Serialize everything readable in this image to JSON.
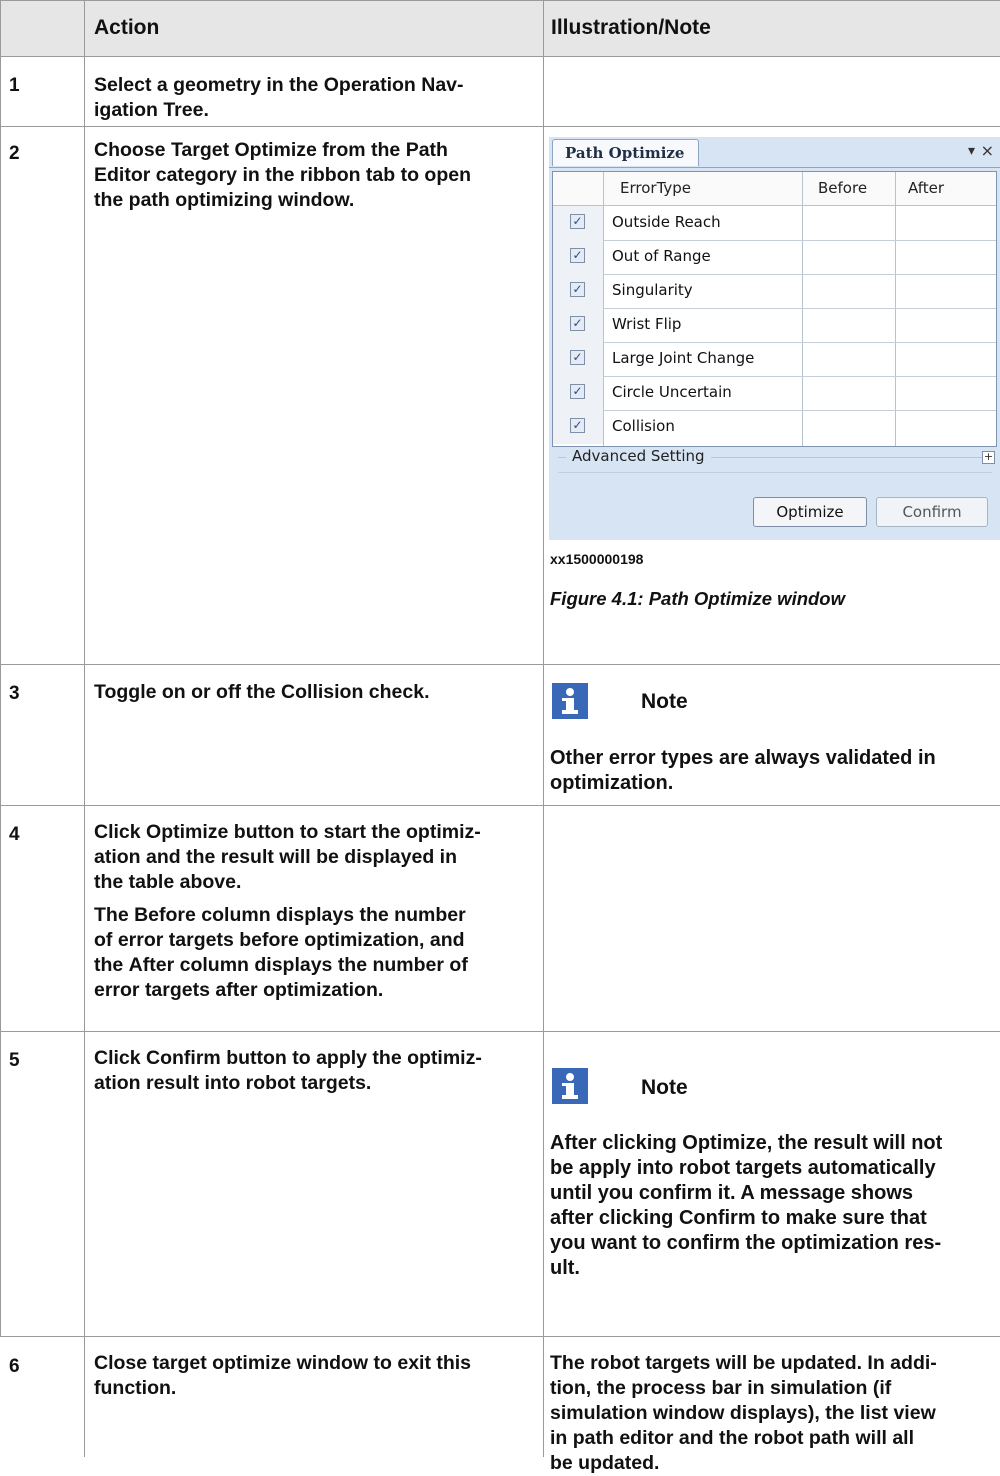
{
  "table": {
    "headers": {
      "step": "",
      "action": "Action",
      "note": "Illustration/Note"
    },
    "rows": [
      {
        "num": "1",
        "action": [
          "Select a geometry in the ",
          "Operation Nav-",
          "igation Tree",
          "."
        ]
      },
      {
        "num": "2",
        "action_line1_pre": "Choose ",
        "action_line1_kw": "Target Optimize",
        "action_line1_post": " from the Path",
        "action_line2": "Editor category in the ribbon tab to open",
        "action_line3": "the path optimizing window."
      },
      {
        "num": "3",
        "action_pre": "Toggle on or off the ",
        "action_kw": "Collision",
        "action_post": " check."
      },
      {
        "num": "4"
      },
      {
        "num": "5"
      },
      {
        "num": "6",
        "action_line1": "Close target optimize window to exit this",
        "action_line2": "function."
      }
    ]
  },
  "widget": {
    "tab_title": "Path Optimize",
    "pin_icon": "▾",
    "close_icon": "×",
    "columns": [
      "ErrorType",
      "Before",
      "After"
    ],
    "error_types": [
      {
        "label": "Outside Reach",
        "checked": true
      },
      {
        "label": "Out of Range",
        "checked": true
      },
      {
        "label": "Singularity",
        "checked": true
      },
      {
        "label": "Wrist Flip",
        "checked": true
      },
      {
        "label": "Large Joint Change",
        "checked": true
      },
      {
        "label": "Circle Uncertain",
        "checked": true
      },
      {
        "label": "Collision",
        "checked": true
      }
    ],
    "advanced_setting": "Advanced Setting",
    "optimize_button": "Optimize",
    "confirm_button": "Confirm"
  },
  "figure": {
    "image_id": "xx1500000198",
    "caption": "Figure 4.1: Path Optimize window"
  },
  "notes": {
    "label": "Note",
    "step3_l1": "Other error types are always validated in",
    "step3_l2": "optimization.",
    "step5_l1_pre": "After clicking ",
    "step5_l1_kw": "Optimize",
    "step5_l1_post": ", the result will not",
    "step5_l2": "be apply into robot targets automatically",
    "step5_l3": "until you confirm it. A message shows",
    "step5_l4_pre": "after clicking ",
    "step5_l4_kw": "Confirm",
    "step5_l4_post": " to make sure that",
    "step5_l5": "you want to confirm the optimization res-",
    "step5_l6": "ult."
  },
  "step4": {
    "l1_pre": "Click ",
    "l1_kw": "Optimize",
    "l1_post": " button to start the optimiz-",
    "l2": "ation and the result will be displayed in",
    "l3": "the table above.",
    "l4_pre": "The ",
    "l4_kw": "Before",
    "l4_post": " column displays the number",
    "l5": "of error targets before optimization, and",
    "l6_pre": "the ",
    "l6_kw": "After",
    "l6_post": " column displays the number of",
    "l7": "error targets after optimization."
  },
  "step5": {
    "l1_pre": "Click ",
    "l1_kw": "Confirm",
    "l1_post": " button to apply the optimiz-",
    "l2": "ation result into robot targets."
  },
  "step6_note": {
    "l1": "The robot targets will be updated. In addi-",
    "l2": "tion, the process bar in simulation (if",
    "l3": "simulation window displays), the list view",
    "l4": "in path editor and the robot path will all",
    "l5": "be updated."
  }
}
